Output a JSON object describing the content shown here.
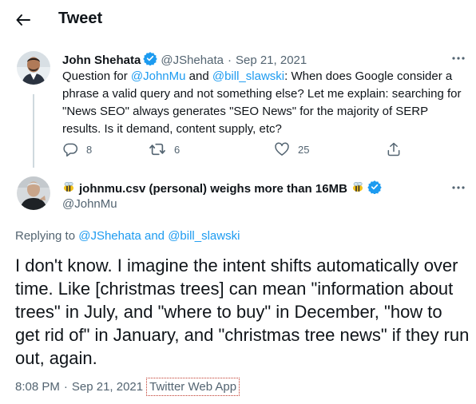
{
  "header": {
    "title": "Tweet"
  },
  "tweet": {
    "author_name": "John Shehata",
    "author_handle": "@JShehata",
    "separator": "·",
    "date": "Sep 21, 2021",
    "body_prefix": "Question for ",
    "mention1": "@JohnMu",
    "body_and": " and ",
    "mention2": "@bill_slawski",
    "body_rest": ": When does Google consider a phrase a valid query and not something else? Let me explain: searching for \"News SEO\" always generates \"SEO News\" for the majority of SERP results. Is it demand, content supply, etc?",
    "replies": "8",
    "retweets": "6",
    "likes": "25"
  },
  "reply": {
    "author_name": "johnmu.csv (personal) weighs more than 16MB",
    "author_handle": "@JohnMu",
    "replying_label": "Replying to ",
    "replying_to": "@JShehata and @bill_slawski",
    "body": "I don't know. I imagine the intent shifts automatically over time. Like [christmas trees] can mean \"information about trees\" in July, and \"where to buy\" in December, \"how to get rid of\" in January, and \"christmas tree news\" if they run out, again.",
    "time": "8:08 PM",
    "separator": "·",
    "date": "Sep 21, 2021",
    "source": "Twitter Web App"
  },
  "colors": {
    "accent": "#1d9bf0",
    "muted": "#536471",
    "text": "#0f1419",
    "thread_line": "#cfd9de"
  }
}
